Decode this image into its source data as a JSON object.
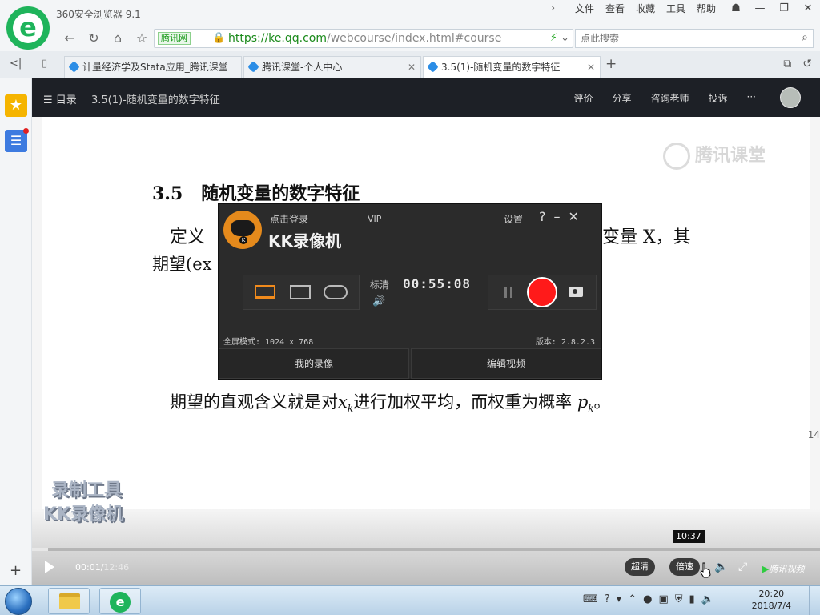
{
  "browser": {
    "app_title": "360安全浏览器 9.1",
    "menu": [
      "文件",
      "查看",
      "收藏",
      "工具",
      "帮助"
    ],
    "url_tag": "腾讯网",
    "url_host": "https://ke.qq.com",
    "url_path": "/webcourse/index.html#course",
    "search_placeholder": "点此搜索",
    "tabs": [
      {
        "label": "计量经济学及Stata应用_腾讯课堂"
      },
      {
        "label": "腾讯课堂-个人中心"
      },
      {
        "label": "3.5(1)-随机变量的数字特征"
      }
    ]
  },
  "course": {
    "menu_label": "目录",
    "title": "3.5(1)-随机变量的数字特征",
    "links": [
      "评价",
      "分享",
      "咨询老师",
      "投诉",
      "···"
    ]
  },
  "slide": {
    "watermark": "腾讯课堂",
    "heading_num": "3.5",
    "heading_text": "随机变量的数字特征",
    "def_left": "定义",
    "def_right": "变量 X，其",
    "expect_text": "期望(ex",
    "meaning_pre": "期望的直观含义就是对",
    "meaning_xk": "x",
    "meaning_k": "k",
    "meaning_mid": "进行加权平均，而权重为概率",
    "meaning_pk": "p",
    "meaning_end": "。",
    "edge_number": "14",
    "rec_watermark_1": "录制工具",
    "rec_watermark_2": "KK录像机"
  },
  "player": {
    "current_time": "00:01",
    "total_time": "12:46",
    "hover_time": "10:37",
    "progress_fraction": 0.001,
    "quality_label": "超清",
    "speed_label": "倍速",
    "brand": "腾讯视频"
  },
  "kk_recorder": {
    "login": "点击登录",
    "vip": "VIP",
    "brand": "KK录像机",
    "settings": "设置",
    "quality": "标清",
    "timer": "00:55:08",
    "mode_text": "全屏模式: 1024 x 768",
    "version": "版本: 2.8.2.3",
    "my_recordings": "我的录像",
    "edit_video": "编辑视频"
  },
  "taskbar": {
    "time": "20:20",
    "date": "2018/7/4"
  },
  "colors": {
    "brand_green": "#1fb45b",
    "record_red": "#ff1a1a",
    "kk_orange": "#e58a1c",
    "header_dark": "#1d2026"
  }
}
